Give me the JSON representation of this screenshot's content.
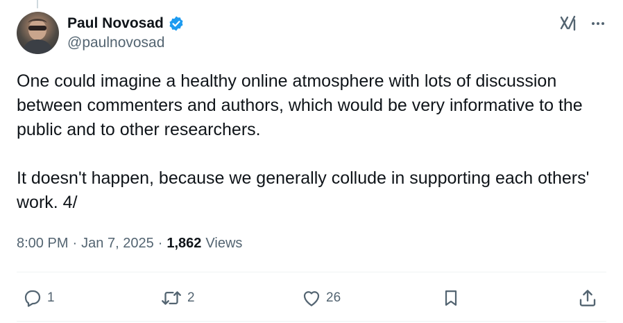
{
  "author": {
    "display_name": "Paul Novosad",
    "handle": "@paulnovosad",
    "verified": true
  },
  "header_icons": [
    "grok-icon",
    "more-icon"
  ],
  "tweet": {
    "paragraphs": [
      "One could imagine a healthy online atmosphere with lots of discussion between commenters and authors, which would be very informative to the public and to other researchers.",
      "It doesn't happen, because we generally collude in supporting each others' work. 4/"
    ]
  },
  "meta": {
    "time": "8:00 PM",
    "separator": "·",
    "date": "Jan 7, 2025",
    "views_count": "1,862",
    "views_label": "Views"
  },
  "actions": {
    "reply_count": "1",
    "retweet_count": "2",
    "like_count": "26"
  },
  "colors": {
    "text": "#0f1419",
    "secondary": "#536471",
    "verified": "#1d9bf0",
    "divider": "#eff3f4"
  }
}
